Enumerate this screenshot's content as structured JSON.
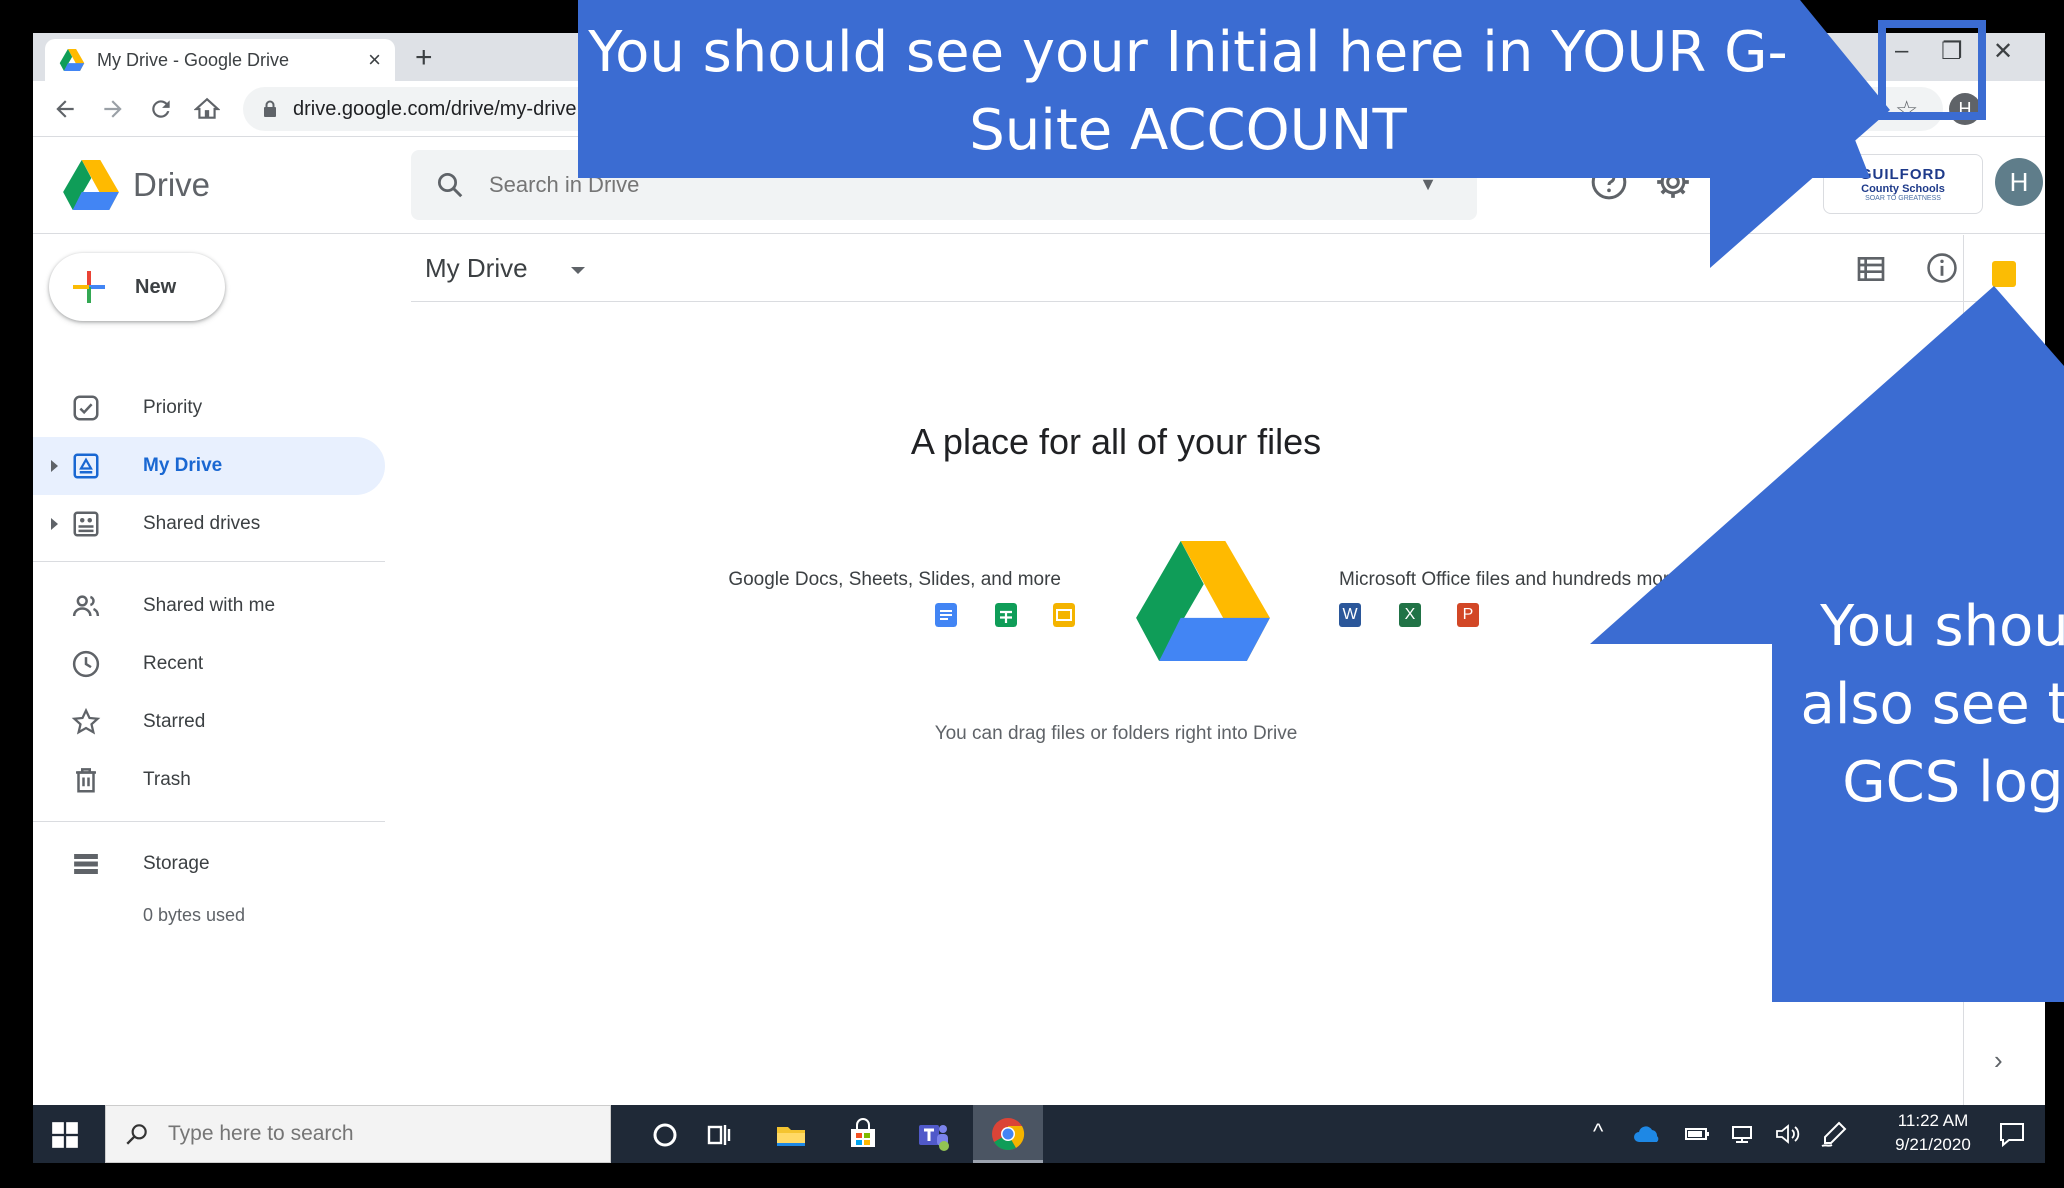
{
  "browser": {
    "tab_title": "My Drive - Google Drive",
    "tab_close": "×",
    "new_tab": "+",
    "minimize": "–",
    "restore": "❐",
    "close": "✕",
    "url": "drive.google.com/drive/my-drive",
    "profile_initial": "H"
  },
  "header": {
    "app_name": "Drive",
    "search_placeholder": "Search in Drive",
    "gcs_logo": {
      "line1": "GUILFORD",
      "line2": "County Schools",
      "line3": "SOAR TO GREATNESS"
    },
    "avatar_initial": "H"
  },
  "sidebar": {
    "new_label": "New",
    "items": [
      {
        "label": "Priority"
      },
      {
        "label": "My Drive"
      },
      {
        "label": "Shared drives"
      },
      {
        "label": "Shared with me"
      },
      {
        "label": "Recent"
      },
      {
        "label": "Starred"
      },
      {
        "label": "Trash"
      },
      {
        "label": "Storage"
      }
    ],
    "storage_used": "0 bytes used"
  },
  "main": {
    "title": "My Drive",
    "empty_title": "A place for all of your files",
    "docs_caption": "Google Docs, Sheets, Slides, and more",
    "office_caption": "Microsoft Office files and hundreds more",
    "office_letters": {
      "word": "W",
      "excel": "X",
      "powerpoint": "P"
    },
    "drag_text": "You can drag files or folders right into Drive"
  },
  "side_panel": {
    "chevron": "›"
  },
  "taskbar": {
    "search_placeholder": "Type here to search",
    "time": "11:22 AM",
    "date": "9/21/2020"
  },
  "annotations": {
    "top_callout": "You should see your Initial here in YOUR G-Suite ACCOUNT",
    "right_callout": "You should also see the GCS logo"
  },
  "colors": {
    "callout_blue": "#3b6cd2",
    "active_nav_bg": "#e8f0fe",
    "active_nav_text": "#1967d2"
  }
}
